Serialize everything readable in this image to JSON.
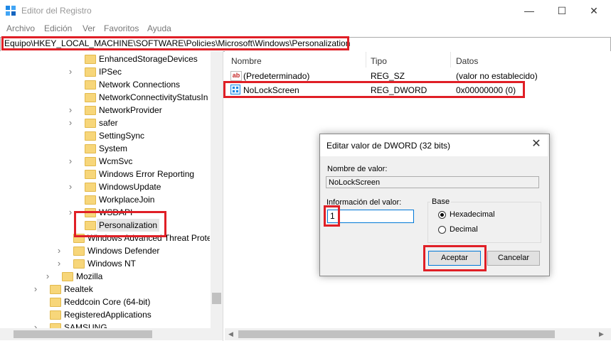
{
  "window": {
    "title": "Editor del Registro",
    "minimize_icon": "—",
    "maximize_icon": "☐",
    "close_icon": "✕"
  },
  "menu": [
    "Archivo",
    "Edición",
    "Ver",
    "Favoritos",
    "Ayuda"
  ],
  "address_bar": {
    "path": "Equipo\\HKEY_LOCAL_MACHINE\\SOFTWARE\\Policies\\Microsoft\\Windows\\Personalization"
  },
  "tree": {
    "items": [
      {
        "label": "EnhancedStorageDevices",
        "expandable": false
      },
      {
        "label": "IPSec",
        "expandable": true
      },
      {
        "label": "Network Connections",
        "expandable": false
      },
      {
        "label": "NetworkConnectivityStatusIn",
        "expandable": false
      },
      {
        "label": "NetworkProvider",
        "expandable": true
      },
      {
        "label": "safer",
        "expandable": true
      },
      {
        "label": "SettingSync",
        "expandable": false
      },
      {
        "label": "System",
        "expandable": false
      },
      {
        "label": "WcmSvc",
        "expandable": true
      },
      {
        "label": "Windows Error Reporting",
        "expandable": false
      },
      {
        "label": "WindowsUpdate",
        "expandable": true
      },
      {
        "label": "WorkplaceJoin",
        "expandable": false
      },
      {
        "label": "WSDAPI",
        "expandable": true
      },
      {
        "label": "Personalization",
        "expandable": false,
        "selected": true
      },
      {
        "label": "Windows Advanced Threat Prote",
        "expandable": false
      },
      {
        "label": "Windows Defender",
        "expandable": true
      },
      {
        "label": "Windows NT",
        "expandable": true
      },
      {
        "label": "Mozilla",
        "expandable": true
      },
      {
        "label": "Realtek",
        "expandable": true
      },
      {
        "label": "Reddcoin Core (64-bit)",
        "expandable": false
      },
      {
        "label": "RegisteredApplications",
        "expandable": false
      },
      {
        "label": "SAMSUNG",
        "expandable": true
      }
    ]
  },
  "list": {
    "columns": [
      "Nombre",
      "Tipo",
      "Datos"
    ],
    "rows": [
      {
        "icon": "ab",
        "name": "(Predeterminado)",
        "type": "REG_SZ",
        "data": "(valor no establecido)"
      },
      {
        "icon": "dword",
        "name": "NoLockScreen",
        "type": "REG_DWORD",
        "data": "0x00000000 (0)"
      }
    ]
  },
  "dialog": {
    "title": "Editar valor de DWORD (32 bits)",
    "close_icon": "✕",
    "value_name_label": "Nombre de valor:",
    "value_name": "NoLockScreen",
    "value_data_label": "Información del valor:",
    "value_data": "1",
    "base_label": "Base",
    "base_options": [
      "Hexadecimal",
      "Decimal"
    ],
    "base_selected": "Hexadecimal",
    "ok_label": "Aceptar",
    "cancel_label": "Cancelar"
  },
  "colors": {
    "highlight": "#e01f26",
    "folder": "#f7d67a",
    "accent": "#0078d7"
  }
}
